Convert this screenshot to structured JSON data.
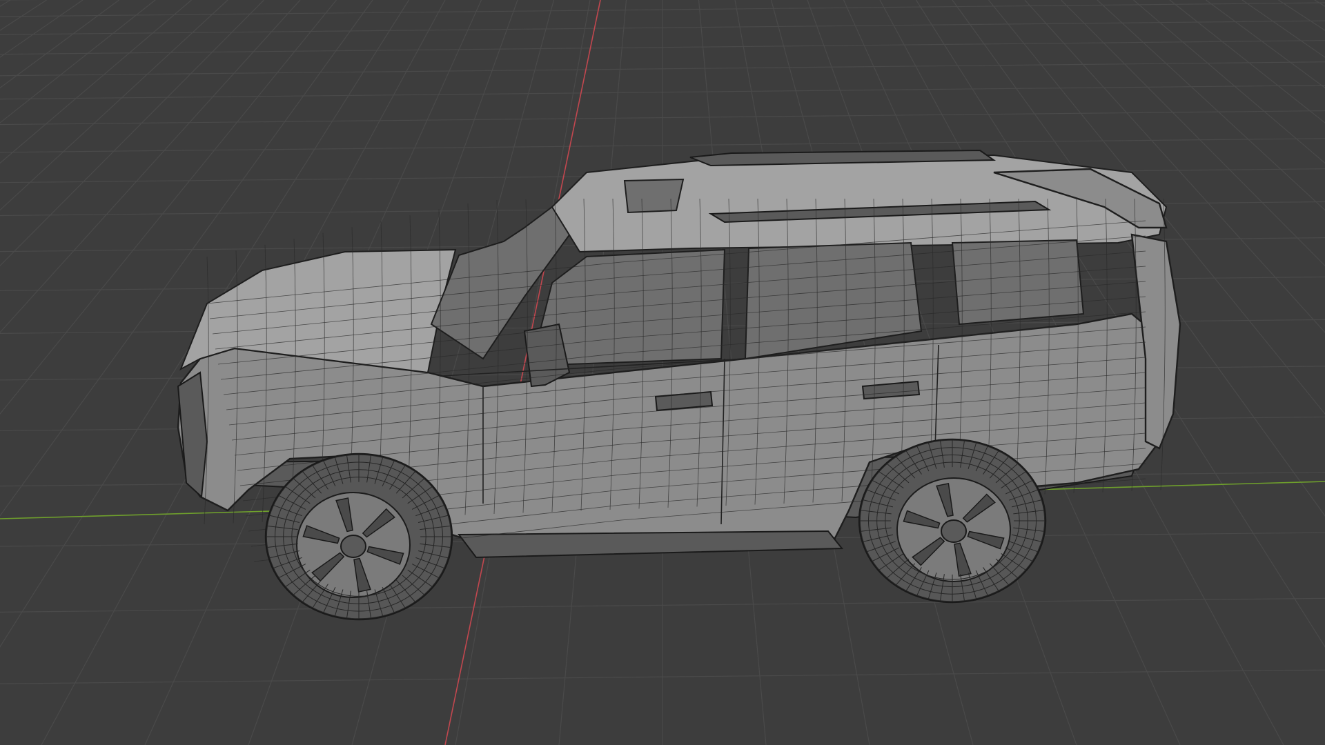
{
  "viewport": {
    "background": "#3d3d3d",
    "grid_color": "#4a4a4a",
    "x_axis_color": "#c2474f",
    "y_axis_color": "#6fa02c",
    "mesh_fill_color": "#8c8c8c",
    "wire_color": "#1e1e1e",
    "shading_mode": "wireframe-solid",
    "object": "suv-3d-model"
  }
}
